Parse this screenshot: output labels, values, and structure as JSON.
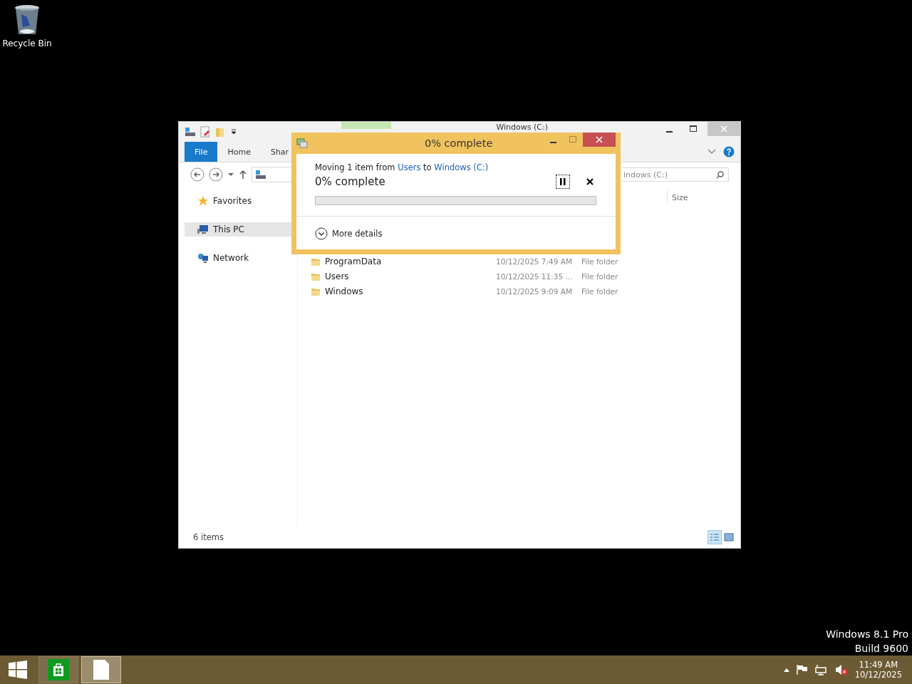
{
  "desktop": {
    "icons": [
      {
        "label": "Recycle Bin"
      }
    ],
    "watermark": [
      "Windows 8.1 Pro",
      "Build 9600"
    ]
  },
  "explorer": {
    "title": "Windows (C:)",
    "ribbon_tabs": [
      {
        "label": "File",
        "selected": true
      },
      {
        "label": "Home",
        "selected": false
      },
      {
        "label": "Shar",
        "selected": false
      }
    ],
    "search": {
      "placeholder": "indows (C:)"
    },
    "nav": [
      {
        "label": "Favorites",
        "kind": "star",
        "selected": false
      },
      {
        "label": "This PC",
        "kind": "pc",
        "selected": true
      },
      {
        "label": "Network",
        "kind": "network",
        "selected": false
      }
    ],
    "columns": [
      "Size"
    ],
    "rows": [
      {
        "name": "ProgramData",
        "date": "10/12/2025 7:49 AM",
        "type": "File folder"
      },
      {
        "name": "Users",
        "date": "10/12/2025 11:35 ...",
        "type": "File folder"
      },
      {
        "name": "Windows",
        "date": "10/12/2025 9:09 AM",
        "type": "File folder"
      }
    ],
    "status": "6 items"
  },
  "dialog": {
    "title": "0% complete",
    "message": "Moving 1 item from ",
    "source": "Users",
    "middle": " to ",
    "target": "Windows (C:)",
    "progress_text": "0% complete",
    "level": 0,
    "more": "More details"
  },
  "taskbar": {
    "apps": [
      {
        "kind": "store",
        "selected": false
      },
      {
        "kind": "file",
        "selected": true
      }
    ],
    "time": "11:49 AM",
    "date": "10/12/2025"
  }
}
